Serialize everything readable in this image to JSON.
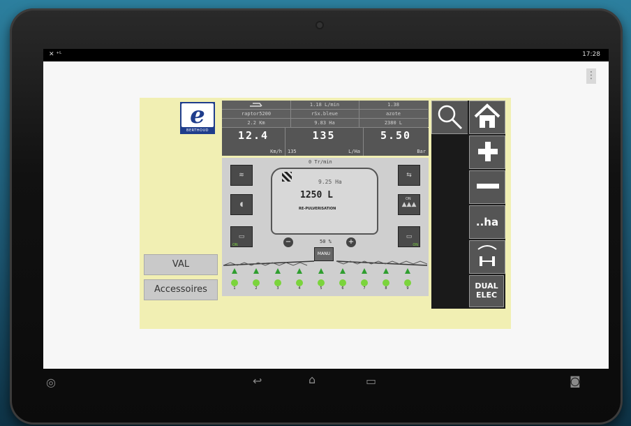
{
  "status": {
    "left_icons": "✕ ⁺ᴸ",
    "time": "17:28"
  },
  "app": {
    "overflow_icon": "⋮"
  },
  "logo": {
    "letter": "e",
    "brand": "BERTHOUD"
  },
  "top_info": [
    {
      "line1": "",
      "line2": "raptor5200",
      "line3": "2.2 Km"
    },
    {
      "line1": "1.18 L/min",
      "line2": "rSx.bleue",
      "line3": "9.83 Ha"
    },
    {
      "line1": "1.38",
      "line2": "azote",
      "line3": "2380 L"
    }
  ],
  "readouts": {
    "speed": {
      "value": "12.4",
      "unit": "Km/h"
    },
    "rate": {
      "value": "135",
      "sub": "135",
      "unit": "L/Ha"
    },
    "pressure": {
      "value": "5.50",
      "unit": "Bar"
    }
  },
  "sprayer": {
    "rpm": "0 Tr/min",
    "area": "9.25 Ha",
    "volume": "1250 L",
    "message": "RE-PULVERISATION",
    "percent": "50 %",
    "manu": "MANU",
    "side_on_1": "ON",
    "side_on_2": "ON",
    "side_on_3": "ON"
  },
  "sections": [
    "1",
    "2",
    "3",
    "4",
    "5",
    "6",
    "7",
    "8",
    "9"
  ],
  "left_buttons": {
    "val": "VAL",
    "accessoires": "Accessoires"
  },
  "icon_buttons": {
    "ha": "..ha",
    "dual": "DUAL",
    "elec": "ELEC"
  },
  "colors": {
    "panel": "#f1efb3",
    "green": "#7bd43c",
    "logo": "#1f3d8c"
  }
}
